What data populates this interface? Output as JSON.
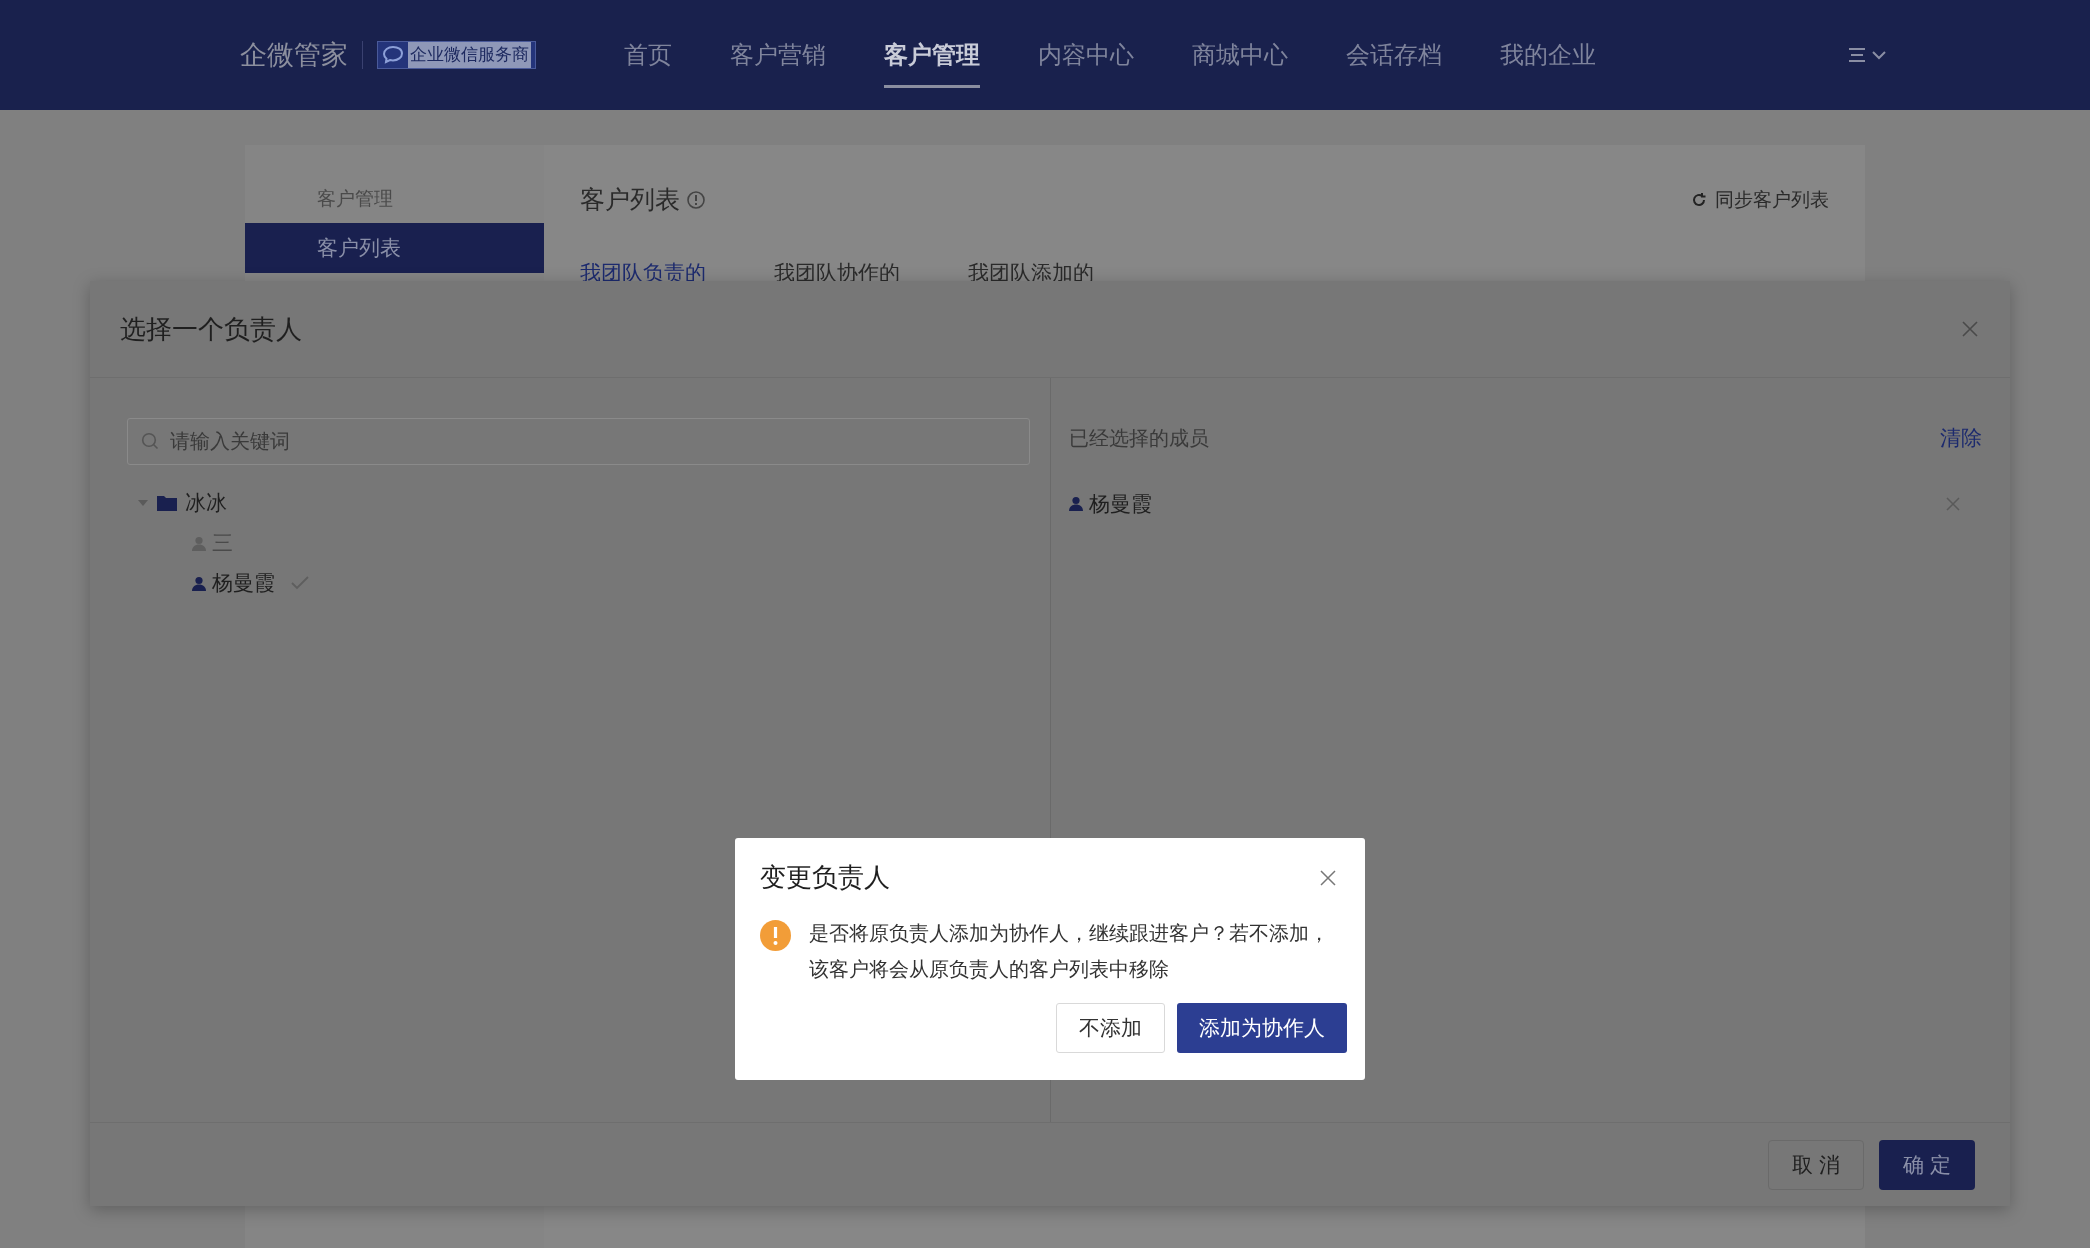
{
  "header": {
    "logo": "企微管家",
    "badge": "企业微信服务商",
    "nav": [
      {
        "label": "首页",
        "selected": false
      },
      {
        "label": "客户营销",
        "selected": false
      },
      {
        "label": "客户管理",
        "selected": true
      },
      {
        "label": "内容中心",
        "selected": false
      },
      {
        "label": "商城中心",
        "selected": false
      },
      {
        "label": "会话存档",
        "selected": false
      },
      {
        "label": "我的企业",
        "selected": false
      }
    ]
  },
  "sidebar": {
    "section": "客户管理",
    "items": [
      {
        "label": "客户列表",
        "selected": true
      }
    ]
  },
  "content": {
    "title": "客户列表",
    "sync_button": "同步客户列表",
    "tabs": [
      {
        "label": "我团队负责的",
        "selected": true
      },
      {
        "label": "我团队协作的",
        "selected": false
      },
      {
        "label": "我团队添加的",
        "selected": false
      }
    ]
  },
  "picker_modal": {
    "title": "选择一个负责人",
    "search": {
      "placeholder": "请输入关键词"
    },
    "tree": [
      {
        "label": "冰冰",
        "kind": "folder",
        "expanded": true,
        "children": [
          {
            "label": "三",
            "kind": "member",
            "disabled": true,
            "selected": false
          },
          {
            "label": "杨曼霞",
            "kind": "member",
            "disabled": false,
            "selected": true
          }
        ]
      }
    ],
    "selected_panel": {
      "title": "已经选择的成员",
      "clear_link": "清除",
      "members": [
        "杨曼霞"
      ]
    },
    "buttons": [
      {
        "label": "取 消",
        "kind": "secondary"
      },
      {
        "label": "确 定",
        "kind": "primary"
      }
    ]
  },
  "confirm_dialog": {
    "title": "变更负责人",
    "message": "是否将原负责人添加为协作人，继续跟进客户？若不添加，该客户将会从原负责人的客户列表中移除",
    "buttons": [
      {
        "label": "不添加",
        "kind": "secondary"
      },
      {
        "label": "添加为协作人",
        "kind": "primary"
      }
    ]
  }
}
